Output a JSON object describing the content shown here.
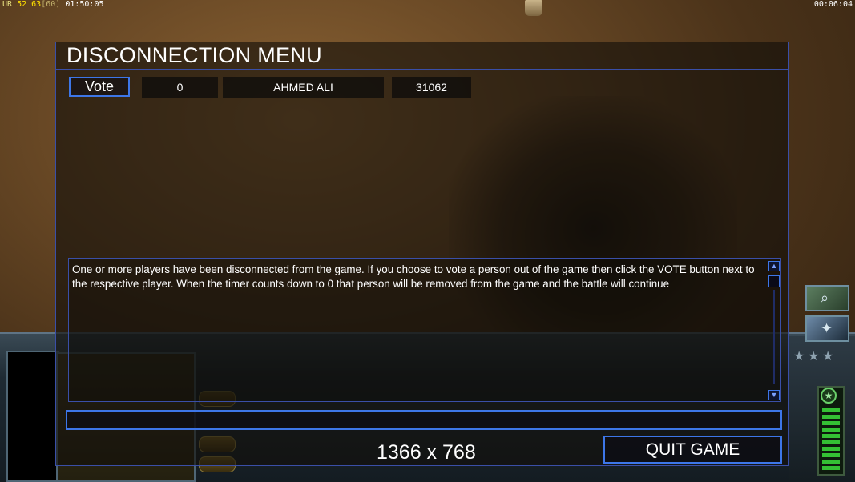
{
  "hud": {
    "top_left": {
      "prefix": "UR",
      "fps_a": "52",
      "fps_b": "63",
      "fps_cap": "[60]",
      "game_time": "01:50:05"
    },
    "top_right_time": "00:06:04"
  },
  "dialog": {
    "title": "DISCONNECTION MENU",
    "player_row": {
      "vote_label": "Vote",
      "vote_count": "0",
      "player_name": "AHMED ALI",
      "ping": "31062"
    },
    "message": "One or more players have been disconnected from the game. If you choose to vote a person out of the game then click the VOTE button next to the respective player. When the timer counts down to 0 that person will be removed from the game and the battle will continue",
    "chat_input_value": "",
    "quit_label": "QUIT GAME",
    "resolution_label": "1366 x 768"
  },
  "side_icons": [
    "magnifier-icon",
    "satellite-icon"
  ],
  "colors": {
    "dialog_border": "#3a4fa8",
    "button_border": "#3d76e8",
    "power_green": "#34c034"
  }
}
